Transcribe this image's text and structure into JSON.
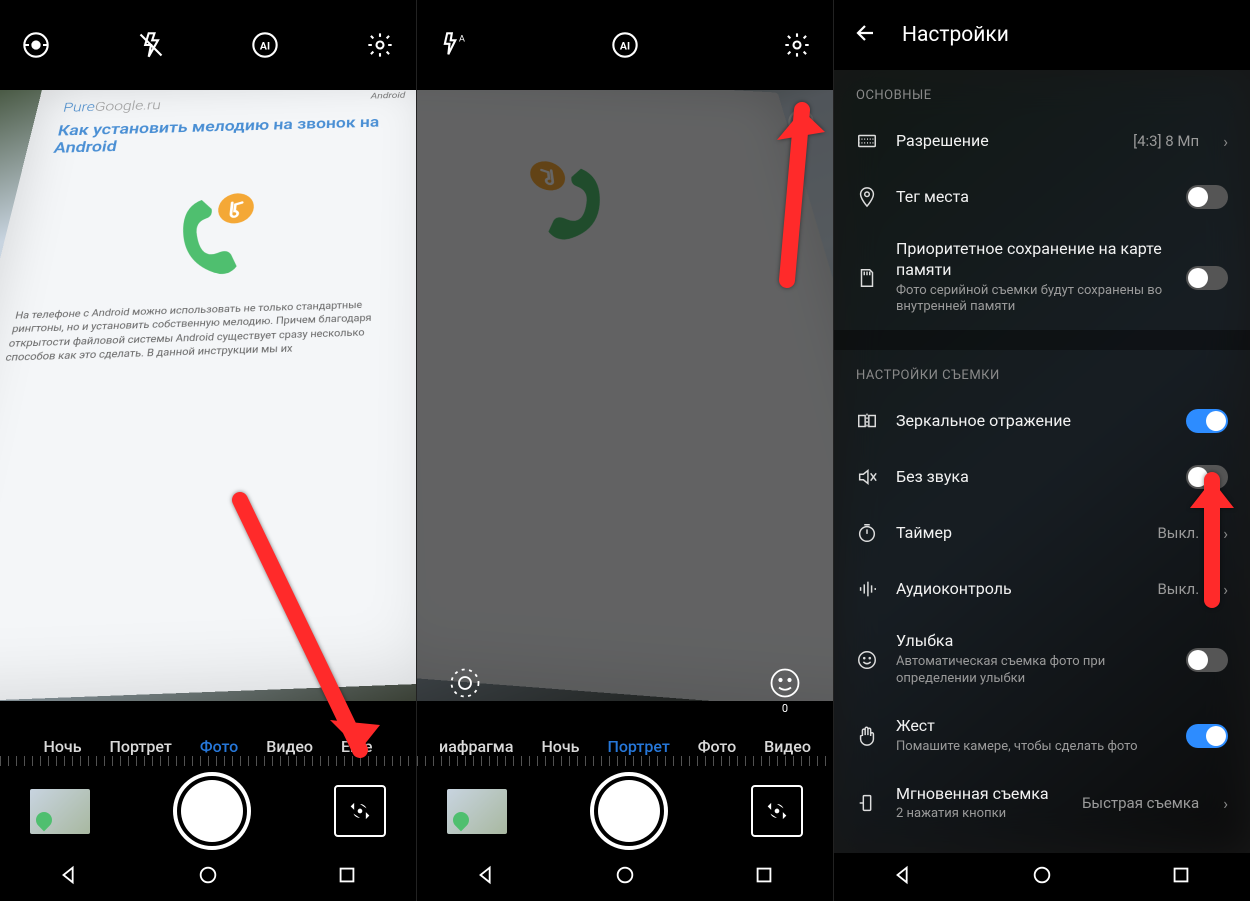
{
  "panel1": {
    "laptop": {
      "brand_pre": "Pure",
      "brand_mid": "Google",
      "brand_suf": ".ru",
      "tag": "Android",
      "headline": "Как установить мелодию на звонок на Android",
      "body": "На телефоне с Android можно использовать не только стандартные рингтоны, но и\nустановить собственную мелодию. Причем благодаря открытости файловой системы\nAndroid существует сразу несколько способов как это сделать. В данной инструкции мы их"
    },
    "modes": [
      "Ночь",
      "Портрет",
      "Фото",
      "Видео",
      "Еще"
    ],
    "active_mode_index": 2
  },
  "panel2": {
    "modes": [
      "иафрагма",
      "Ночь",
      "Портрет",
      "Фото",
      "Видео"
    ],
    "active_mode_index": 2,
    "beauty_count": "0"
  },
  "panel3": {
    "title": "Настройки",
    "groups": {
      "main": {
        "label": "ОСНОВНЫЕ"
      },
      "shooting": {
        "label": "НАСТРОЙКИ СЪЕМКИ"
      }
    },
    "items": {
      "resolution": {
        "label": "Разрешение",
        "value": "[4:3] 8 Мп"
      },
      "geotag": {
        "label": "Тег места"
      },
      "sdpriority": {
        "label": "Приоритетное сохранение на карте памяти",
        "sub": "Фото серийной съемки будут сохранены во внутренней памяти"
      },
      "mirror": {
        "label": "Зеркальное отражение"
      },
      "mute": {
        "label": "Без звука"
      },
      "timer": {
        "label": "Таймер",
        "value": "Выкл."
      },
      "audio": {
        "label": "Аудиоконтроль",
        "value": "Выкл."
      },
      "smile": {
        "label": "Улыбка",
        "sub": "Автоматическая съемка фото при определении улыбки"
      },
      "gesture": {
        "label": "Жест",
        "sub": "Помашите камере, чтобы сделать фото"
      },
      "quickshot": {
        "label": "Мгновенная съемка",
        "sub": "2 нажатия кнопки",
        "value": "Быстрая съемка"
      }
    }
  }
}
